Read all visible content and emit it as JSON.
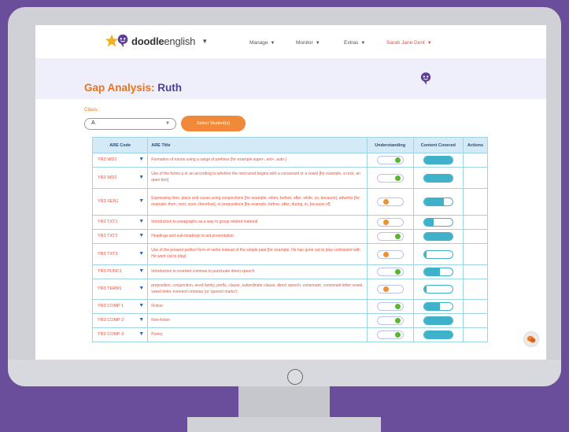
{
  "nav": {
    "brand_bold": "doodle",
    "brand_light": "english",
    "items": [
      {
        "label": "Manage"
      },
      {
        "label": "Monitor"
      },
      {
        "label": "Extras"
      }
    ],
    "user": "Sarah Jane Dent"
  },
  "page": {
    "title_prefix": "Gap Analysis:",
    "title_name": "Ruth"
  },
  "class_filter": {
    "label": "Class:",
    "value": "A",
    "button": "Select Student(s)"
  },
  "table": {
    "headers": [
      "ARE Code",
      "ARE Title",
      "Understanding",
      "Content Covered",
      "Actions"
    ],
    "rows": [
      {
        "code": "YR3 WD1",
        "title": "Formation of nouns using a range of prefixes [for example super-, anti-, auto-]",
        "understanding": "green",
        "covered": 1.0
      },
      {
        "code": "YR3 WD2",
        "title": "Use of the forms a or an according to whether the next word begins with a consonant or a vowel [for example, a rock, an open box]",
        "understanding": "green",
        "covered": 1.0
      },
      {
        "code": "YR3 SEN1",
        "title": "Expressing time, place and cause using conjunctions [for example, when, before, after, while, so, because], adverbs [for example, then, next, soon, therefore], or prepositions [for example, before, after, during, in, because of]",
        "understanding": "orange",
        "covered": 0.7
      },
      {
        "code": "YR3 TXT1",
        "title": "Introduction to paragraphs as a way to group related material",
        "understanding": "orange",
        "covered": 0.35
      },
      {
        "code": "YR3 TXT2",
        "title": "Headings and sub-headings to aid presentation",
        "understanding": "green",
        "covered": 1.0
      },
      {
        "code": "YR3 TXT3",
        "title": "Use of the present perfect form of verbs instead of the simple past [for example, He has gone out to play contrasted with He went out to play]",
        "understanding": "orange",
        "covered": 0.1
      },
      {
        "code": "YR3 PUNC1",
        "title": "Introduction to inverted commas to punctuate direct speech",
        "understanding": "green",
        "covered": 0.55
      },
      {
        "code": "YR3 TERM1",
        "title": "preposition, conjunction, word family, prefix, clause, subordinate clause, direct speech, consonant, consonant letter vowel, vowel letter, inverted commas (or 'speech marks')",
        "understanding": "orange",
        "covered": 0.1
      },
      {
        "code": "YR3 COMP 1",
        "title": "Fiction",
        "understanding": "green",
        "covered": 0.55
      },
      {
        "code": "YR3 COMP 2",
        "title": "Non-fiction",
        "understanding": "green",
        "covered": 1.0
      },
      {
        "code": "YR3 COMP 3",
        "title": "Poetry",
        "understanding": "green",
        "covered": 1.0
      }
    ]
  },
  "colors": {
    "accent_orange": "#e9741d",
    "title_purple": "#4f3e97",
    "understanding_green": "#5cb436",
    "understanding_orange": "#ef8f2f",
    "covered_teal": "#3fb1c9"
  },
  "icons": [
    "star-logo-icon",
    "doodle-face-icon",
    "chevron-down-icon",
    "row-expand-triangle-icon",
    "chat-bubble-icon",
    "power-button-icon"
  ]
}
